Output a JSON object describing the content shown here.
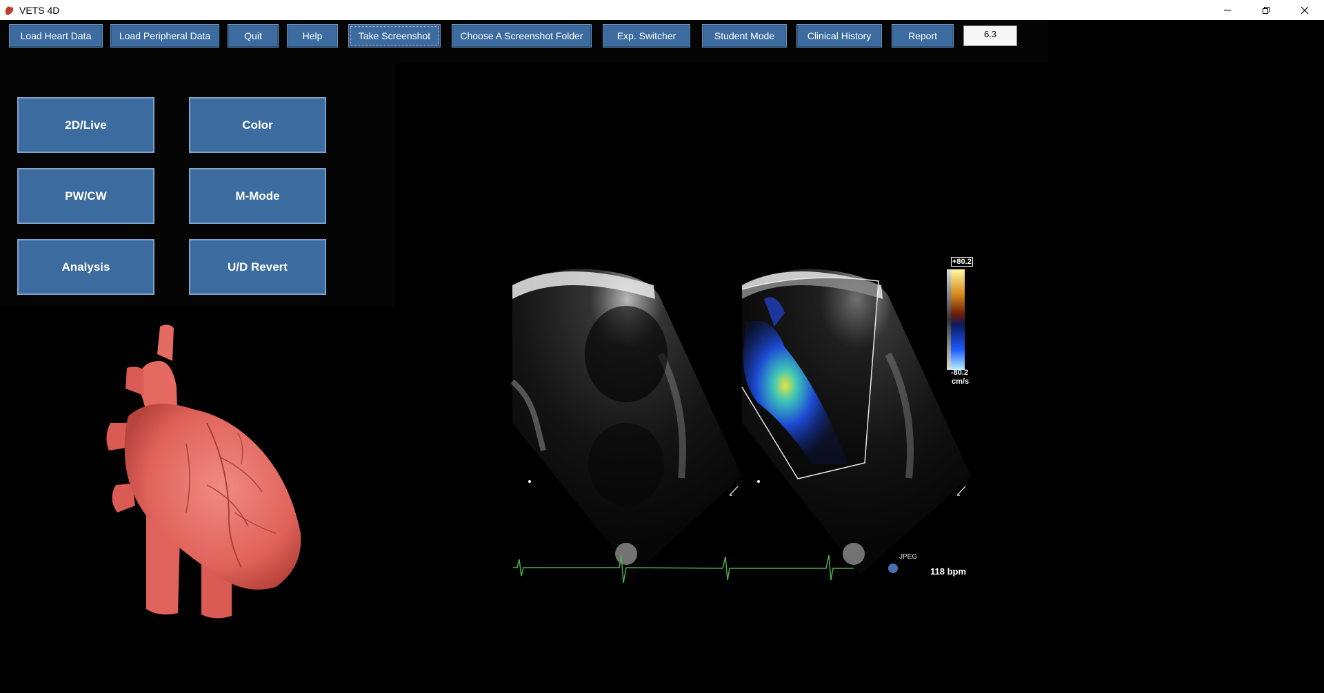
{
  "window": {
    "title": "VETS 4D",
    "controls": [
      "minimize",
      "restore",
      "close"
    ]
  },
  "toolbar": {
    "buttons": [
      {
        "label": "Load Heart Data"
      },
      {
        "label": "Load Peripheral Data"
      },
      {
        "label": "Quit"
      },
      {
        "label": "Help"
      },
      {
        "label": "Take Screenshot"
      },
      {
        "label": "Choose A Screenshot Folder"
      },
      {
        "label": "Exp. Switcher"
      },
      {
        "label": "Student Mode"
      },
      {
        "label": "Clinical History"
      },
      {
        "label": "Report"
      }
    ],
    "version": "6.3"
  },
  "modes": [
    {
      "label": "2D/Live"
    },
    {
      "label": "Color"
    },
    {
      "label": "PW/CW"
    },
    {
      "label": "M-Mode"
    },
    {
      "label": "Analysis"
    },
    {
      "label": "U/D Revert"
    }
  ],
  "echo": {
    "scale_max": "+80.2",
    "scale_min": "-80.2",
    "scale_unit": "cm/s",
    "jpeg_label": "JPEG",
    "heart_rate": "118 bpm"
  },
  "colors": {
    "button_fill": "#3c6c9f",
    "heart_model": "#e8675f",
    "ecg_trace": "#4fae4f"
  }
}
